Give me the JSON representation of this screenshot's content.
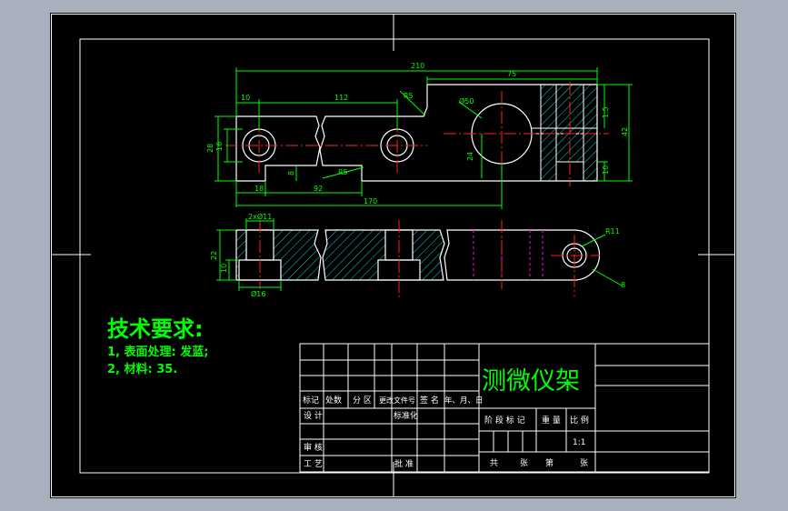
{
  "colors": {
    "background": "#a8b0bd",
    "sheet": "#000000",
    "frame": "#ffffff",
    "part": "#ffffff",
    "centerline": "#ff2020",
    "hidden": "#ff00ff",
    "hatch": "#00d8d8",
    "dimension": "#00ff00",
    "title_text": "#00ff00"
  },
  "drawing": {
    "top_dims": {
      "overall": "210",
      "right": "75",
      "left_edge": "10",
      "hole_spacing": "112",
      "r_notch": "R5",
      "circle_dia": "Ø50",
      "height": "28",
      "hole_height": "16",
      "notch_width": "18",
      "notch_depth": "8",
      "lower_span": "92",
      "r_lower": "R5",
      "bottom_span": "170",
      "inner_24": "24",
      "side_15": "1.5",
      "side_42": "42",
      "side_10": "10"
    },
    "bottom_dims": {
      "hole_top": "2xØ11",
      "height_22": "22",
      "height_10": "10",
      "hole_bottom": "Ø16",
      "radius": "R11",
      "thickness": "8"
    }
  },
  "tech": {
    "heading": "技术要求:",
    "line1": "1, 表面处理: 发蓝;",
    "line2": "2, 材料: 35."
  },
  "title_block": {
    "part_name": "测微仪架",
    "row_labels": [
      "标记",
      "处数",
      "分 区",
      "更改文件号",
      "签 名",
      "年、月、日"
    ],
    "design": "设 计",
    "standardize": "标准化",
    "review": "审 核",
    "process": "工 艺",
    "approve": "批 准",
    "stage_labels": [
      "阶 段 标 记",
      "重 量",
      "比 例"
    ],
    "scale": "1:1",
    "sheet_info": [
      "共",
      "张",
      "第",
      "张"
    ]
  }
}
